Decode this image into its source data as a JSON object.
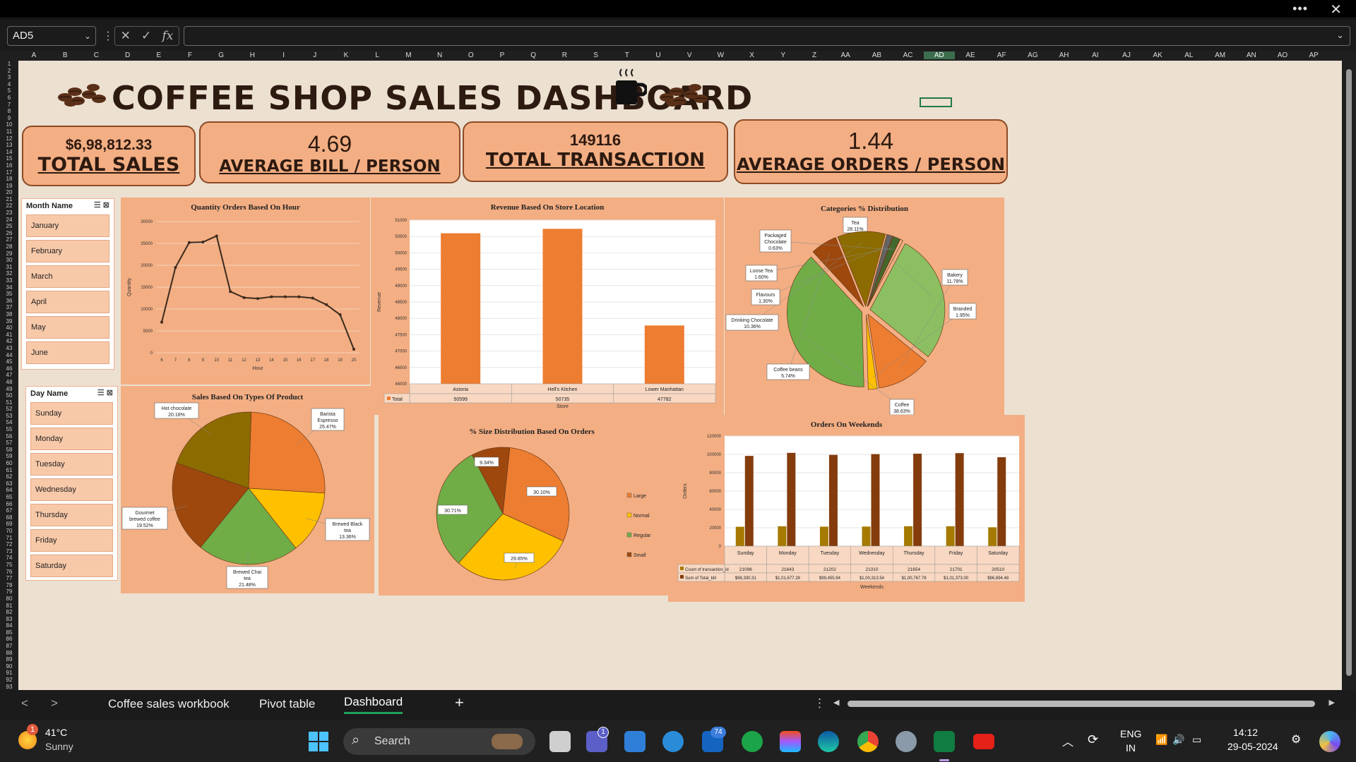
{
  "window": {
    "more": "•••",
    "close": "✕"
  },
  "formula_bar": {
    "name_box": "AD5",
    "formula": ""
  },
  "columns": [
    "A",
    "B",
    "C",
    "D",
    "E",
    "F",
    "G",
    "H",
    "I",
    "J",
    "K",
    "L",
    "M",
    "N",
    "O",
    "P",
    "Q",
    "R",
    "S",
    "T",
    "U",
    "V",
    "W",
    "X",
    "Y",
    "Z",
    "AA",
    "AB",
    "AC",
    "AD",
    "AE",
    "AF",
    "AG",
    "AH",
    "AI",
    "AJ",
    "AK",
    "AL",
    "AM",
    "AN",
    "AO",
    "AP"
  ],
  "dashboard": {
    "title": "COFFEE SHOP SALES DASHBOARD",
    "kpis": [
      {
        "value": "$6,98,812.33",
        "label": "TOTAL SALES"
      },
      {
        "value": "4.69",
        "label": "AVERAGE BILL / PERSON"
      },
      {
        "value": "149116",
        "label": "TOTAL TRANSACTION"
      },
      {
        "value": "1.44",
        "label": "AVERAGE ORDERS / PERSON"
      }
    ],
    "month_slicer": {
      "title": "Month Name",
      "items": [
        "January",
        "February",
        "March",
        "April",
        "May",
        "June"
      ]
    },
    "day_slicer": {
      "title": "Day Name",
      "items": [
        "Sunday",
        "Monday",
        "Tuesday",
        "Wednesday",
        "Thursday",
        "Friday",
        "Saturday"
      ]
    }
  },
  "chart_data": [
    {
      "type": "line",
      "title": "Quantity Orders Based On Hour",
      "xlabel": "Hour",
      "ylabel": "Quantity",
      "x": [
        6,
        7,
        8,
        9,
        10,
        11,
        12,
        13,
        14,
        15,
        16,
        17,
        18,
        19,
        20
      ],
      "values": [
        7000,
        19500,
        25200,
        25300,
        26700,
        14000,
        12600,
        12400,
        12800,
        12800,
        12800,
        12500,
        11000,
        8700,
        800
      ],
      "yticks": [
        0,
        5000,
        10000,
        15000,
        20000,
        25000,
        30000
      ],
      "ylim": [
        0,
        30000
      ],
      "color": "#3b2a1e"
    },
    {
      "type": "bar",
      "title": "Revenue Based On Store Location",
      "xlabel": "Store",
      "ylabel": "Revenue",
      "categories": [
        "Astoria",
        "Hell's Kitchen",
        "Lower Manhattan"
      ],
      "values": [
        50599,
        50735,
        47782
      ],
      "table_label": "Total",
      "yticks": [
        46000,
        46500,
        47000,
        47500,
        48000,
        48500,
        49000,
        49500,
        50000,
        50500,
        51000
      ],
      "ylim": [
        46000,
        51000
      ],
      "color": "#ed7d31"
    },
    {
      "type": "pie",
      "title": "Categories % Distribution",
      "slices": [
        {
          "name": "Tea",
          "pct": "28.11%",
          "value": 28.11,
          "color": "#8cbf62"
        },
        {
          "name": "Bakery",
          "pct": "11.78%",
          "value": 11.78,
          "color": "#ed7d31"
        },
        {
          "name": "Branded",
          "pct": "1.95%",
          "value": 1.95,
          "color": "#ffc000"
        },
        {
          "name": "Coffee",
          "pct": "38.63%",
          "value": 38.63,
          "color": "#70ad47"
        },
        {
          "name": "Coffee beans",
          "pct": "5.74%",
          "value": 5.74,
          "color": "#9e480e"
        },
        {
          "name": "Drinking Chocolate",
          "pct": "10.36%",
          "value": 10.36,
          "color": "#8c6c00"
        },
        {
          "name": "Flavours",
          "pct": "1.30%",
          "value": 1.3,
          "color": "#636363"
        },
        {
          "name": "Loose Tea",
          "pct": "1.60%",
          "value": 1.6,
          "color": "#43682b"
        },
        {
          "name": "Packaged Chocolate",
          "pct": "0.63%",
          "value": 0.63,
          "color": "#f4b183"
        }
      ]
    },
    {
      "type": "pie",
      "title": "Sales Based On Types Of Product",
      "slices": [
        {
          "name": "Barista Espresso",
          "pct": "25.47%",
          "value": 25.47,
          "color": "#ed7d31"
        },
        {
          "name": "Brewed Black tea",
          "pct": "13.36%",
          "value": 13.36,
          "color": "#ffc000"
        },
        {
          "name": "Brewed Chai tea",
          "pct": "21.48%",
          "value": 21.48,
          "color": "#70ad47"
        },
        {
          "name": "Gourmet brewed coffee",
          "pct": "19.52%",
          "value": 19.52,
          "color": "#9e480e"
        },
        {
          "name": "Hot chocolate",
          "pct": "20.18%",
          "value": 20.18,
          "color": "#8c6c00"
        }
      ]
    },
    {
      "type": "pie",
      "title": "% Size Distribution  Based On Orders",
      "slices": [
        {
          "name": "Large",
          "pct": "30.10%",
          "value": 30.1,
          "color": "#ed7d31"
        },
        {
          "name": "Normal",
          "pct": "29.85%",
          "value": 29.85,
          "color": "#ffc000"
        },
        {
          "name": "Regular",
          "pct": "30.71%",
          "value": 30.71,
          "color": "#70ad47"
        },
        {
          "name": "Small",
          "pct": "9.34%",
          "value": 9.34,
          "color": "#9e480e"
        }
      ]
    },
    {
      "type": "bar",
      "title": "Orders On Weekends",
      "xlabel": "Weekends",
      "ylabel": "Orders",
      "categories": [
        "Sunday",
        "Monday",
        "Tuesday",
        "Wednesday",
        "Thursday",
        "Friday",
        "Saturday"
      ],
      "series": [
        {
          "name": "Count of transaction_id",
          "values": [
            21096,
            21643,
            21202,
            21310,
            21654,
            21701,
            20510
          ],
          "labels": [
            "21096",
            "21643",
            "21202",
            "21310",
            "21654",
            "21701",
            "20510"
          ],
          "color": "#a67a00"
        },
        {
          "name": "Sum of Total_bill",
          "values": [
            98330.31,
            101677.28,
            99455.94,
            100313.54,
            100767.78,
            101373.0,
            96894.48
          ],
          "labels": [
            "$98,330.31",
            "$1,01,677.28",
            "$99,455.94",
            "$1,00,313.54",
            "$1,00,767.78",
            "$1,01,373.00",
            "$96,894.48"
          ],
          "color": "#843c0c"
        }
      ],
      "yticks": [
        0,
        20000,
        40000,
        60000,
        80000,
        100000,
        120000
      ],
      "ylim": [
        0,
        120000
      ]
    }
  ],
  "sheet_tabs": [
    "Coffee sales workbook",
    "Pivot table",
    "Dashboard"
  ],
  "active_tab": "Dashboard",
  "taskbar": {
    "weather_temp": "41°C",
    "weather_desc": "Sunny",
    "weather_badge": "1",
    "search": "Search",
    "lang": "ENG",
    "region": "IN",
    "time": "14:12",
    "date": "29-05-2024",
    "badge_teams": "1",
    "badge_outlook": "74"
  }
}
